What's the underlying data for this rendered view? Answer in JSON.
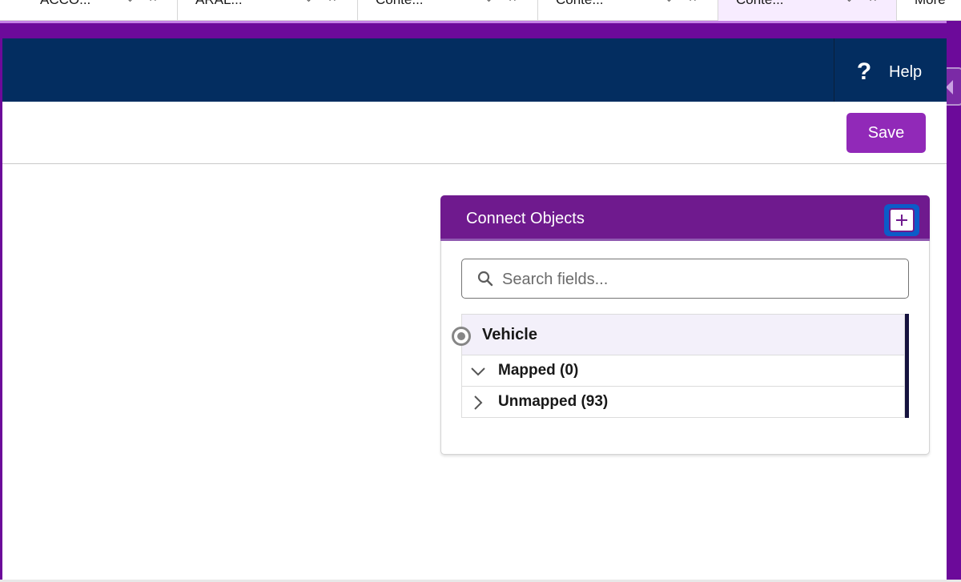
{
  "tabs": [
    {
      "label": "ACCO..."
    },
    {
      "label": "ARAL..."
    },
    {
      "label": "Conte..."
    },
    {
      "label": "Conte..."
    },
    {
      "label": "Conte..."
    },
    {
      "label": "More"
    }
  ],
  "colors": {
    "brand_purple": "#6c0a9a",
    "header_navy": "#032d60",
    "save_button": "#9129b8",
    "panel_header": "#6f1a8e",
    "focus_blue": "#0b5cc9"
  },
  "header": {
    "help_icon": "question-icon",
    "help_label": "Help"
  },
  "toolbar": {
    "save_label": "Save"
  },
  "connect_objects": {
    "title": "Connect Objects",
    "add_icon": "plus-icon",
    "search": {
      "placeholder": "Search fields...",
      "value": ""
    },
    "object": {
      "name": "Vehicle",
      "selected": true
    },
    "groups": [
      {
        "label": "Mapped (0)",
        "expanded": true,
        "icon": "chevron-down-icon"
      },
      {
        "label": "Unmapped (93)",
        "expanded": false,
        "icon": "chevron-right-icon"
      }
    ]
  }
}
